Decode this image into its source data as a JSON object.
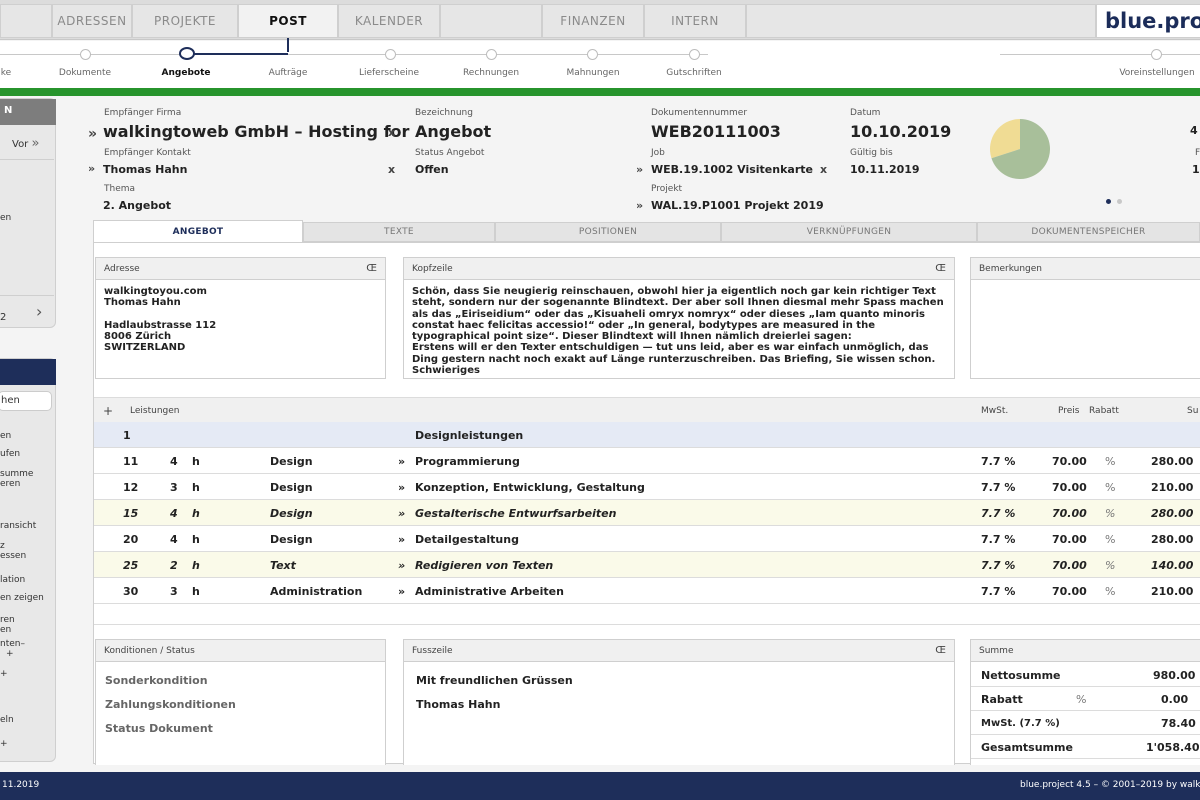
{
  "topnav": {
    "tabs": [
      {
        "label": "ADRESSEN",
        "active": false
      },
      {
        "label": "PROJEKTE",
        "active": false
      },
      {
        "label": "POST",
        "active": true
      },
      {
        "label": "KALENDER",
        "active": false
      },
      {
        "label": "FINANZEN",
        "active": false
      },
      {
        "label": "INTERN",
        "active": false
      }
    ],
    "logo": "blue.proj"
  },
  "stepper": {
    "steps": [
      "ke",
      "Dokumente",
      "Angebote",
      "Aufträge",
      "Lieferscheine",
      "Rechnungen",
      "Mahnungen",
      "Gutschriften",
      "Voreinstellungen"
    ],
    "active": "Angebote"
  },
  "sidebar": {
    "head1": "N",
    "vor": "Vor",
    "item_en": "en",
    "page_num": "2",
    "search_value": "hen",
    "items": [
      "en",
      "ufen",
      "summe",
      "eren",
      "ransicht",
      "z",
      "essen",
      "lation",
      "en zeigen",
      "ren",
      "en",
      "nten–",
      "+",
      "+",
      "eln",
      "+"
    ]
  },
  "header": {
    "empfaenger_firma_label": "Empfänger Firma",
    "empfaenger_firma": "walkingtoweb GmbH – Hosting for",
    "empfaenger_kontakt_label": "Empfänger Kontakt",
    "empfaenger_kontakt": "Thomas Hahn",
    "thema_label": "Thema",
    "thema": "2. Angebot",
    "bezeichnung_label": "Bezeichnung",
    "bezeichnung": "Angebot",
    "status_label": "Status Angebot",
    "status": "Offen",
    "dokumentennummer_label": "Dokumentennummer",
    "dokumentennummer": "WEB20111003",
    "job_label": "Job",
    "job": "WEB.19.1002 Visitenkarte",
    "projekt_label": "Projekt",
    "projekt": "WAL.19.P1001 Projekt 2019",
    "datum_label": "Datum",
    "datum": "10.10.2019",
    "gueltig_label": "Gültig bis",
    "gueltig": "10.11.2019",
    "right_val1": "4",
    "right_val2": "1",
    "right_lbl": "F",
    "pie": {
      "values": [
        0.3,
        0.7
      ],
      "colors": [
        "#f0dc94",
        "#a8bf9a"
      ]
    }
  },
  "doctabs": [
    "ANGEBOT",
    "TEXTE",
    "POSITIONEN",
    "VERKNÜPFUNGEN",
    "DOKUMENTENSPEICHER"
  ],
  "adresse": {
    "label": "Adresse",
    "text": "walkingtoyou.com\nThomas Hahn\n\nHadlaubstrasse 112\n8006 Zürich\nSWITZERLAND"
  },
  "kopfzeile": {
    "label": "Kopfzeile",
    "text": "Schön, dass Sie neugierig reinschauen, obwohl hier ja eigentlich noch gar kein richtiger Text steht, sondern nur der sogenannte Blindtext. Der aber soll Ihnen diesmal mehr Spass machen als das „Eiriseidium“ oder das „Kisuaheli omryx nomryx“ oder dieses „Iam quanto minoris constat haec felicitas accessio!“ oder „In general, bodytypes are measured in the typographical point size“. Dieser Blindtext will Ihnen nämlich dreierlei sagen:\nErstens will er den Texter entschuldigen — tut uns leid, aber es war einfach unmöglich, das Ding gestern nacht noch exakt auf Länge runterzuschreiben. Das Briefing, Sie wissen schon. Schwieriges"
  },
  "bemerkungen": {
    "label": "Bemerkungen"
  },
  "oe": "Œ",
  "table": {
    "plus": "+",
    "header": {
      "leistungen": "Leistungen",
      "mwst": "MwSt.",
      "preis": "Preis",
      "rabatt": "Rabatt",
      "summe": "Su"
    },
    "group": {
      "nr": "1",
      "title": "Designleistungen"
    },
    "rows": [
      {
        "nr": "11",
        "qty": "4",
        "unit": "h",
        "cat": "Design",
        "desc": "Programmierung",
        "mwst": "7.7 %",
        "preis": "70.00",
        "rabatt": "%",
        "summe": "280.00"
      },
      {
        "nr": "12",
        "qty": "3",
        "unit": "h",
        "cat": "Design",
        "desc": "Konzeption, Entwicklung, Gestaltung",
        "mwst": "7.7 %",
        "preis": "70.00",
        "rabatt": "%",
        "summe": "210.00"
      },
      {
        "nr": "15",
        "qty": "4",
        "unit": "h",
        "cat": "Design",
        "desc": "Gestalterische Entwurfsarbeiten",
        "mwst": "7.7 %",
        "preis": "70.00",
        "rabatt": "%",
        "summe": "280.00"
      },
      {
        "nr": "20",
        "qty": "4",
        "unit": "h",
        "cat": "Design",
        "desc": "Detailgestaltung",
        "mwst": "7.7 %",
        "preis": "70.00",
        "rabatt": "%",
        "summe": "280.00"
      },
      {
        "nr": "25",
        "qty": "2",
        "unit": "h",
        "cat": "Text",
        "desc": "Redigieren von Texten",
        "mwst": "7.7 %",
        "preis": "70.00",
        "rabatt": "%",
        "summe": "140.00"
      },
      {
        "nr": "30",
        "qty": "3",
        "unit": "h",
        "cat": "Administration",
        "desc": "Administrative Arbeiten",
        "mwst": "7.7 %",
        "preis": "70.00",
        "rabatt": "%",
        "summe": "210.00"
      }
    ]
  },
  "konditionen": {
    "label": "Konditionen / Status",
    "items": [
      "Sonderkondition",
      "Zahlungskonditionen",
      "Status Dokument"
    ]
  },
  "fusszeile": {
    "label": "Fusszeile",
    "line1": "Mit freundlichen Grüssen",
    "line2": "Thomas Hahn"
  },
  "summe": {
    "label": "Summe",
    "netto_label": "Nettosumme",
    "netto": "980.00",
    "rabatt_label": "Rabatt",
    "rabatt_pct": "%",
    "rabatt": "0.00",
    "mwst_label": "MwSt. (7.7 %)",
    "mwst": "78.40",
    "gesamt_label": "Gesamtsumme",
    "gesamt": "1'058.40"
  },
  "footer": {
    "left": "11.2019",
    "right": "blue.project 4.5 – © 2001–2019 by walk"
  }
}
